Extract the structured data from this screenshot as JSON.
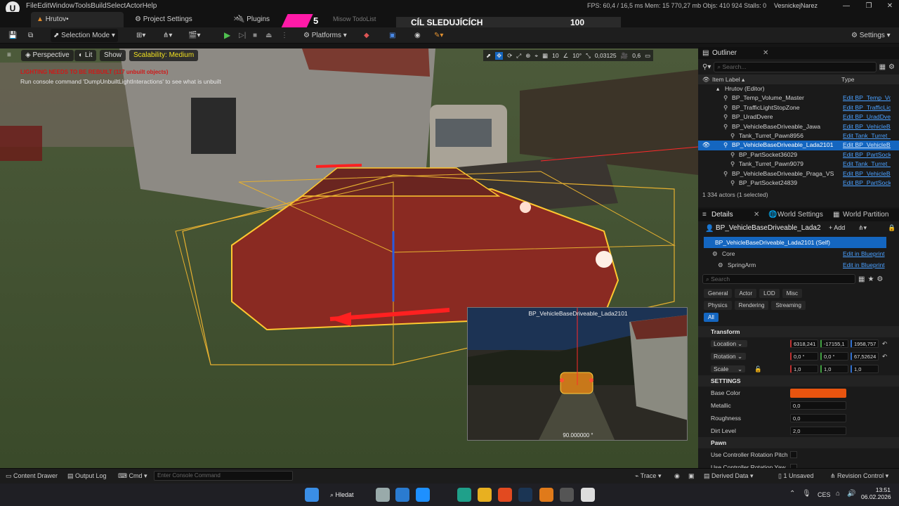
{
  "menu": [
    "File",
    "Edit",
    "Window",
    "Tools",
    "Build",
    "Select",
    "Actor",
    "Help"
  ],
  "tabs": {
    "level": "Hrutov•",
    "project_settings": "Project Settings",
    "plugins": "Plugins"
  },
  "stream": {
    "count": "5",
    "todo": "Misow TodoList",
    "goal": "CÍL SLEDUJÍCÍCH",
    "goal_value": "100"
  },
  "stats": "FPS: 60,4  /  16,5 ms   Mem: 15 770,27 mb   Objs: 410 924   Stalls: 0",
  "project_name": "VesnickejNarez",
  "toolbar": {
    "selection_mode": "Selection Mode",
    "platforms": "Platforms",
    "settings": "Settings"
  },
  "viewport": {
    "perspective": "Perspective",
    "lit": "Lit",
    "show": "Show",
    "scalability": "Scalability: Medium",
    "warning": "LIGHTING NEEDS TO BE REBUILT (117 unbuilt objects)",
    "hint": "Run console command 'DumpUnbuiltLightInteractions' to see what is unbuilt",
    "grid": "10",
    "angle": "10°",
    "scale": "0,03125",
    "cam": "0,6",
    "pip_title": "BP_VehicleBaseDriveable_Lada2101",
    "pip_fov": "90.000000 °"
  },
  "outliner": {
    "title": "Outliner",
    "search": "Search...",
    "col_label": "Item Label ▴",
    "col_type": "Type",
    "rows": [
      {
        "label": "Hrutov (Editor)",
        "type": "",
        "indent": 0,
        "sel": false
      },
      {
        "label": "BP_Temp_Volume_Master",
        "type": "Edit BP_Temp_Vo",
        "indent": 1,
        "sel": false
      },
      {
        "label": "BP_TrafficLightStopZone",
        "type": "Edit BP_TrafficLic",
        "indent": 1,
        "sel": false
      },
      {
        "label": "BP_UradDvere",
        "type": "Edit BP_UradDvei",
        "indent": 1,
        "sel": false
      },
      {
        "label": "BP_VehicleBaseDriveable_Jawa",
        "type": "Edit BP_VehicleBa",
        "indent": 1,
        "sel": false
      },
      {
        "label": "Tank_Turret_Pawn8956",
        "type": "Edit Tank_Turret_",
        "indent": 2,
        "sel": false
      },
      {
        "label": "BP_VehicleBaseDriveable_Lada2101",
        "type": "Edit BP_VehicleBa",
        "indent": 1,
        "sel": true
      },
      {
        "label": "BP_PartSocket36029",
        "type": "Edit BP_PartSock",
        "indent": 2,
        "sel": false
      },
      {
        "label": "Tank_Turret_Pawn9079",
        "type": "Edit Tank_Turret_",
        "indent": 2,
        "sel": false
      },
      {
        "label": "BP_VehicleBaseDriveable_Praga_VS",
        "type": "Edit BP_VehicleBa",
        "indent": 1,
        "sel": false
      },
      {
        "label": "BP_PartSocket24839",
        "type": "Edit BP_PartSock",
        "indent": 2,
        "sel": false
      }
    ],
    "count": "1 334 actors (1 selected)"
  },
  "details": {
    "tab_details": "Details",
    "tab_world": "World Settings",
    "tab_partition": "World Partition",
    "actor_name": "BP_VehicleBaseDriveable_Lada2",
    "add": "+ Add",
    "self": "BP_VehicleBaseDriveable_Lada2101 (Self)",
    "components": [
      {
        "name": "Core",
        "link": "Edit in Blueprint"
      },
      {
        "name": "SpringArm",
        "link": "Edit in Blueprint"
      }
    ],
    "search": "Search",
    "filters": [
      "General",
      "Actor",
      "LOD",
      "Misc",
      "Physics",
      "Rendering",
      "Streaming",
      "All"
    ],
    "transform": "Transform",
    "location": {
      "label": "Location",
      "x": "6318,241",
      "y": "-17155,1",
      "z": "1958,757"
    },
    "rotation": {
      "label": "Rotation",
      "x": "0,0 °",
      "y": "0,0 °",
      "z": "67,52624"
    },
    "scale": {
      "label": "Scale",
      "x": "1,0",
      "y": "1,0",
      "z": "1,0"
    },
    "settings": "SETTINGS",
    "base_color": {
      "label": "Base Color",
      "hex": "#e8540f"
    },
    "metallic": {
      "label": "Metallic",
      "value": "0,0"
    },
    "roughness": {
      "label": "Roughness",
      "value": "0,0"
    },
    "dirt": {
      "label": "Dirt Level",
      "value": "2,0"
    },
    "pawn": "Pawn",
    "pitch": "Use Controller Rotation Pitch",
    "yaw": "Use Controller Rotation Yaw"
  },
  "status": {
    "content_drawer": "Content Drawer",
    "output_log": "Output Log",
    "cmd": "Cmd",
    "console_placeholder": "Enter Console Command",
    "trace": "Trace",
    "derived": "Derived Data",
    "unsaved": "1 Unsaved",
    "revision": "Revision Control"
  },
  "taskbar": {
    "search": "Hledat",
    "lang": "CES",
    "time": "13:51",
    "date": "06.02.2026"
  },
  "colors": {
    "accent": "#1466c0",
    "selected_outline": "#ffc830",
    "car": "#8a2a22"
  }
}
